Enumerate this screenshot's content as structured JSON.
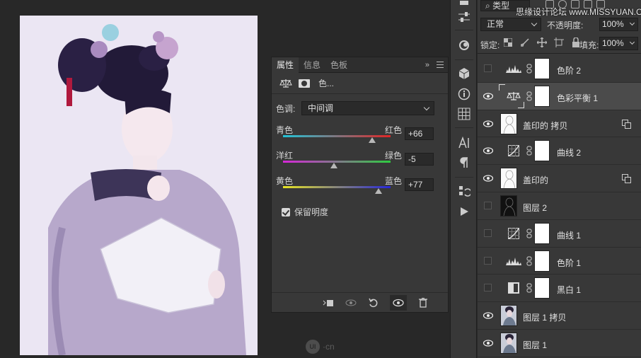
{
  "properties": {
    "tabs": [
      {
        "label": "属性"
      },
      {
        "label": "信息"
      },
      {
        "label": "色板"
      }
    ],
    "more": "»",
    "header_title": "色...",
    "tone_label": "色调:",
    "tone_value": "中间调",
    "sliders": [
      {
        "left": "青色",
        "right": "红色",
        "value": "+66",
        "fraction": 0.83
      },
      {
        "left": "洋红",
        "right": "绿色",
        "value": "-5",
        "fraction": 0.475
      },
      {
        "left": "黄色",
        "right": "蓝色",
        "value": "+77",
        "fraction": 0.885
      }
    ],
    "preserve_luminosity": "保留明度"
  },
  "watermark": {
    "logo": "UI",
    "text": "·cn",
    "site": "思缘设计论坛 www.MISSYUAN.COM"
  },
  "layers_panel": {
    "kind_label": "类型",
    "blend_mode": "正常",
    "opacity_label": "不透明度:",
    "opacity_value": "100%",
    "lock_label": "锁定:",
    "fill_label": "填充:",
    "fill_value": "100%",
    "layers": [
      {
        "name": "色阶 2",
        "visible": false,
        "type": "levels-icon"
      },
      {
        "name": "色彩平衡 1",
        "visible": true,
        "type": "color-balance-icon",
        "selected": true
      },
      {
        "name": "盖印的 拷贝",
        "visible": true,
        "type": "sketch-thumbnail",
        "smart": true
      },
      {
        "name": "曲线 2",
        "visible": true,
        "type": "curves-icon"
      },
      {
        "name": "盖印的",
        "visible": true,
        "type": "sketch-thumbnail",
        "smart": true
      },
      {
        "name": "图层 2",
        "visible": false,
        "type": "dark-thumbnail"
      },
      {
        "name": "曲线 1",
        "visible": false,
        "type": "curves-icon"
      },
      {
        "name": "色阶 1",
        "visible": false,
        "type": "levels-icon"
      },
      {
        "name": "黑白 1",
        "visible": false,
        "type": "black-white-icon"
      },
      {
        "name": "图层 1 拷贝",
        "visible": true,
        "type": "photo-thumbnail"
      },
      {
        "name": "图层 1",
        "visible": true,
        "type": "photo-thumbnail"
      }
    ]
  },
  "colors": {
    "panel_bg": "#383838",
    "canvas_bg": "#282828",
    "photo_bg": "#e9e4f2",
    "cyan_red_track": [
      "#22c4d8",
      "#e02626"
    ],
    "magenta_green_track": [
      "#d627d8",
      "#2ecc40"
    ],
    "yellow_blue_track": [
      "#e8e522",
      "#2626d8"
    ]
  }
}
